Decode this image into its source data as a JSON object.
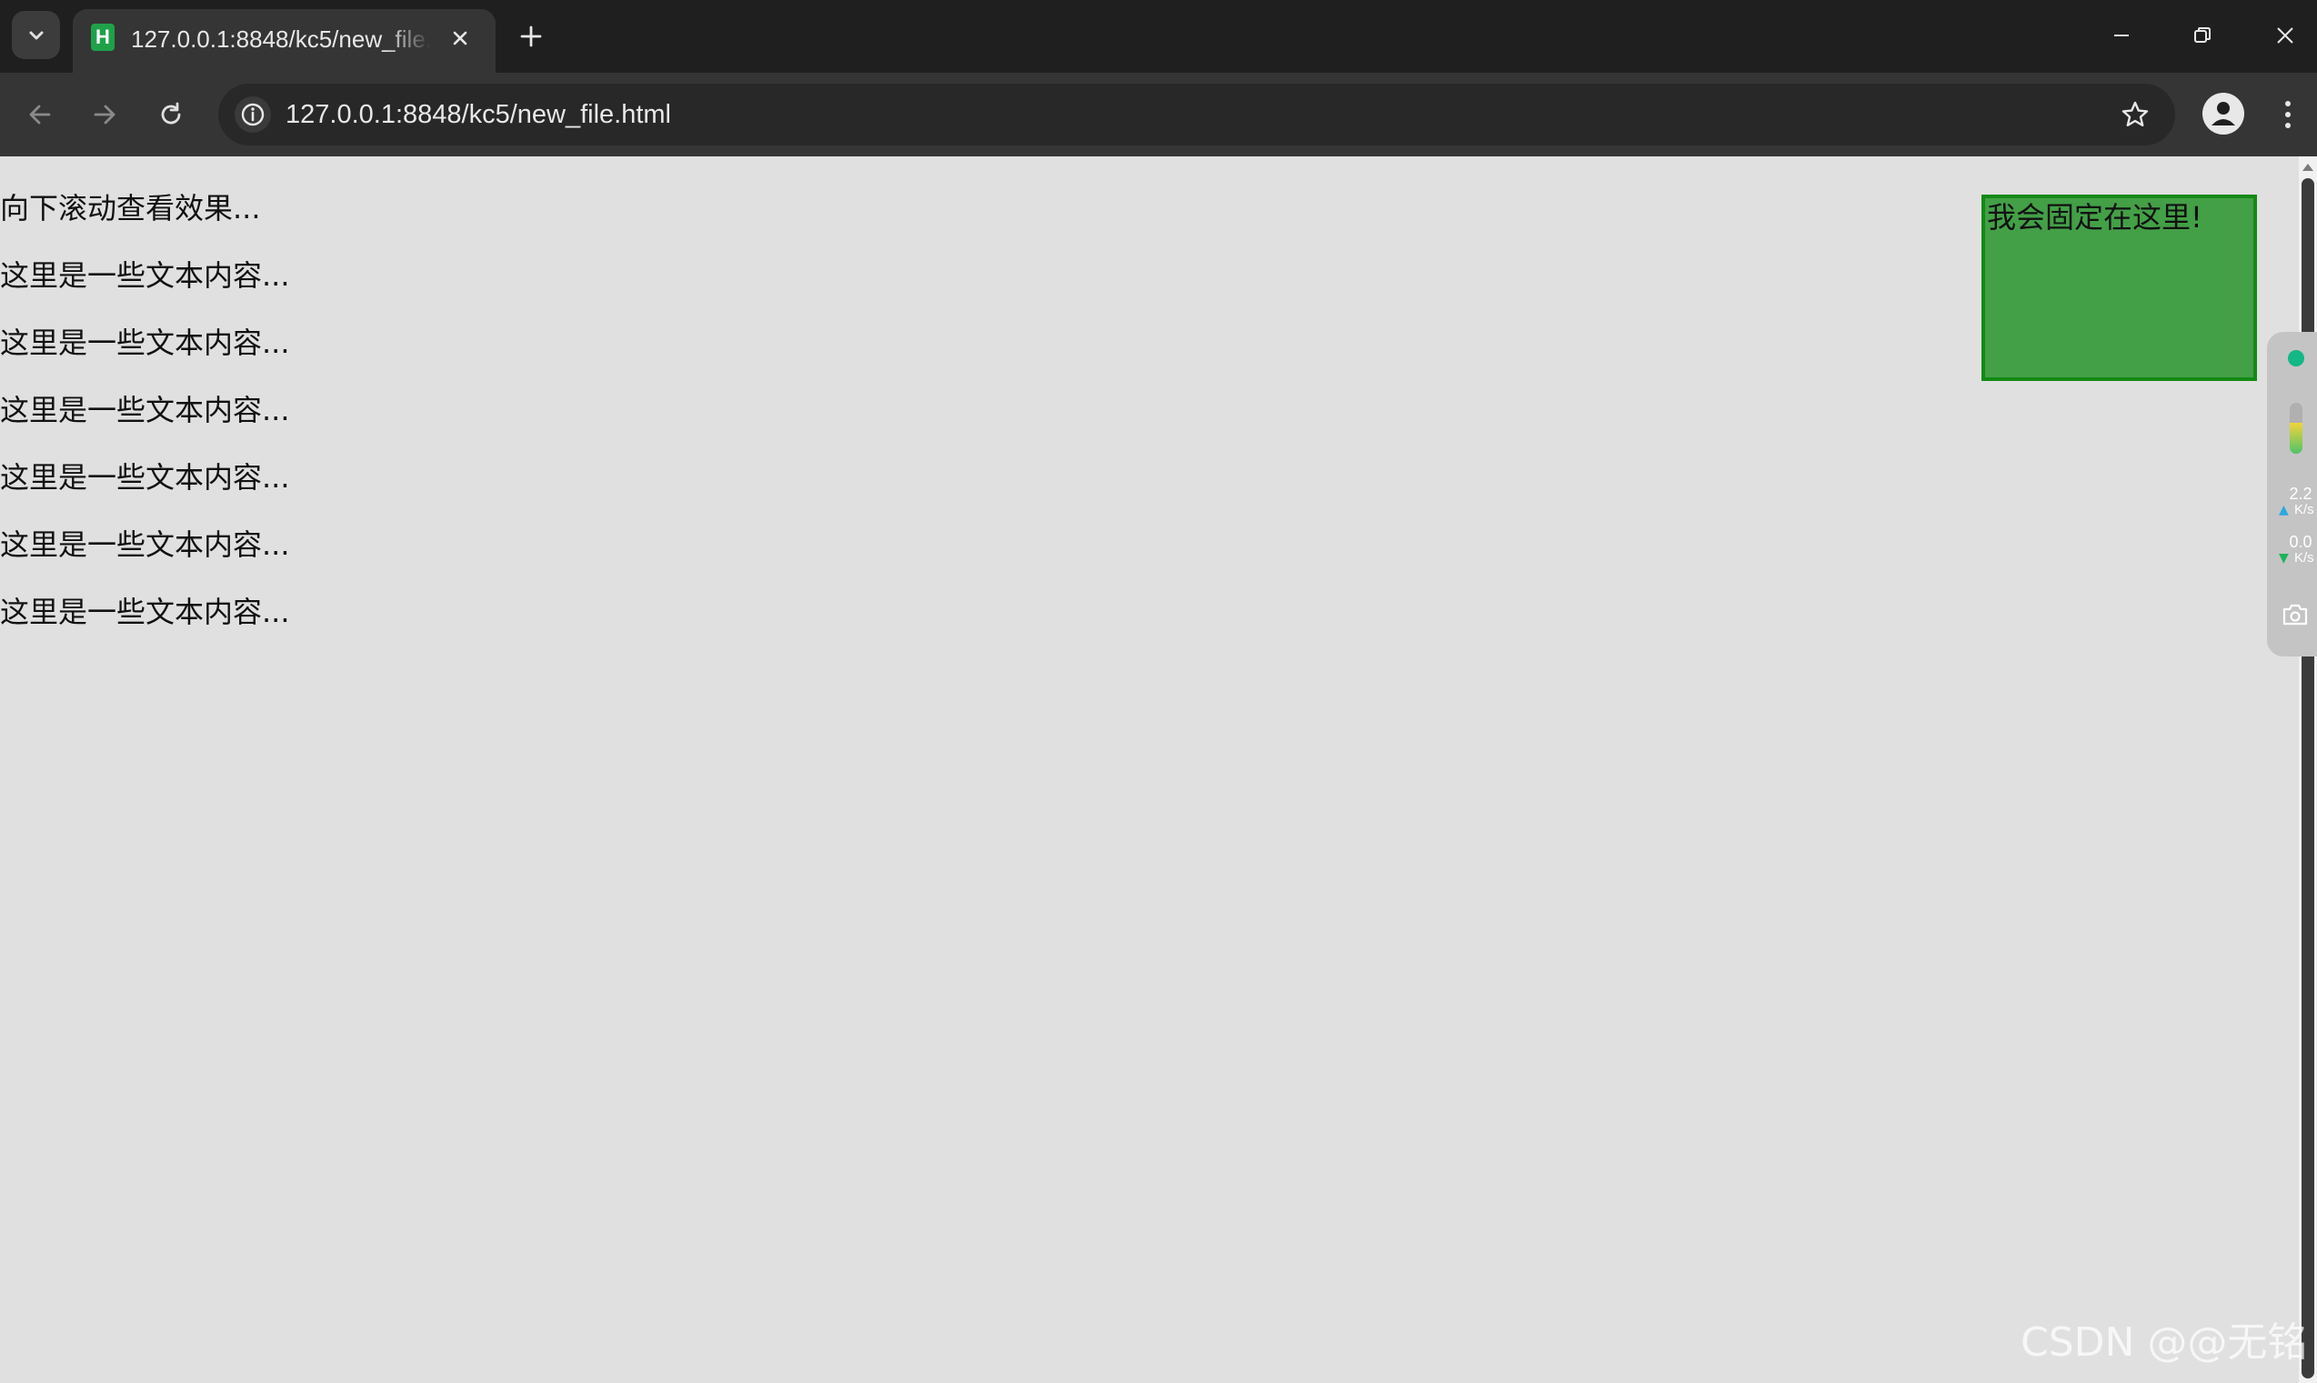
{
  "browser": {
    "tab": {
      "title": "127.0.0.1:8848/kc5/new_file.html",
      "favicon_letter": "H"
    },
    "address_bar": {
      "url": "127.0.0.1:8848/kc5/new_file.html"
    }
  },
  "page": {
    "intro_text": "向下滚动查看效果...",
    "paragraphs": [
      "这里是一些文本内容...",
      "这里是一些文本内容...",
      "这里是一些文本内容...",
      "这里是一些文本内容...",
      "这里是一些文本内容...",
      "这里是一些文本内容..."
    ],
    "fixed_box_text": "我会固定在这里!"
  },
  "network_monitor": {
    "upload_value": "2.2",
    "upload_unit": "K/s",
    "download_value": "0.0",
    "download_unit": "K/s",
    "usage_level": 0.6
  },
  "watermark": "CSDN @@无铭",
  "colors": {
    "page_background": "#e0e0e0",
    "fixed_box_fill": "#43a047",
    "fixed_box_border": "#138a13",
    "chrome_dark": "#1f1f1f",
    "toolbar": "#353535"
  }
}
